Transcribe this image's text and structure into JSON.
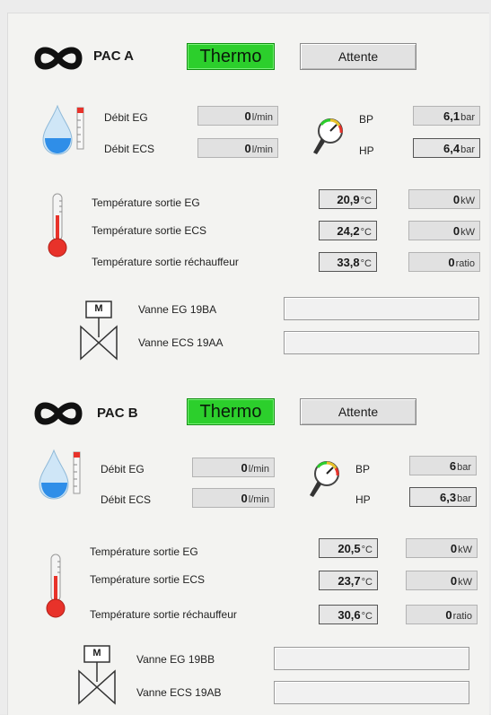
{
  "units": {
    "flow": "l/min",
    "pressure": "bar",
    "temp": "°C",
    "power": "kW",
    "ratio": "ratio"
  },
  "labels": {
    "debit_eg": "Débit EG",
    "debit_ecs": "Débit ECS",
    "bp": "BP",
    "hp": "HP",
    "temp_eg": "Température sortie EG",
    "temp_ecs": "Température sortie ECS",
    "temp_rech": "Température sortie réchauffeur",
    "valve_letter": "M"
  },
  "pac_a": {
    "title": "PAC A",
    "mode": "Thermo",
    "state_button": "Attente",
    "debit_eg": "0",
    "debit_ecs": "0",
    "bp": "6,1",
    "hp": "6,4",
    "temp_eg": "20,9",
    "temp_ecs": "24,2",
    "temp_rech": "33,8",
    "power_eg": "0",
    "power_ecs": "0",
    "ratio": "0",
    "valve_eg": "Vanne EG 19BA",
    "valve_ecs": "Vanne ECS 19AA",
    "valve_eg_value": "",
    "valve_ecs_value": ""
  },
  "pac_b": {
    "title": "PAC B",
    "mode": "Thermo",
    "state_button": "Attente",
    "debit_eg": "0",
    "debit_ecs": "0",
    "bp": "6",
    "hp": "6,3",
    "temp_eg": "20,5",
    "temp_ecs": "23,7",
    "temp_rech": "30,6",
    "power_eg": "0",
    "power_ecs": "0",
    "ratio": "0",
    "valve_eg": "Vanne EG 19BB",
    "valve_ecs": "Vanne ECS 19AB",
    "valve_eg_value": "",
    "valve_ecs_value": ""
  },
  "colors": {
    "mode_green": "#2ccf2c",
    "drop_blue": "#2f8ee8",
    "thermo_red": "#e8322a"
  }
}
